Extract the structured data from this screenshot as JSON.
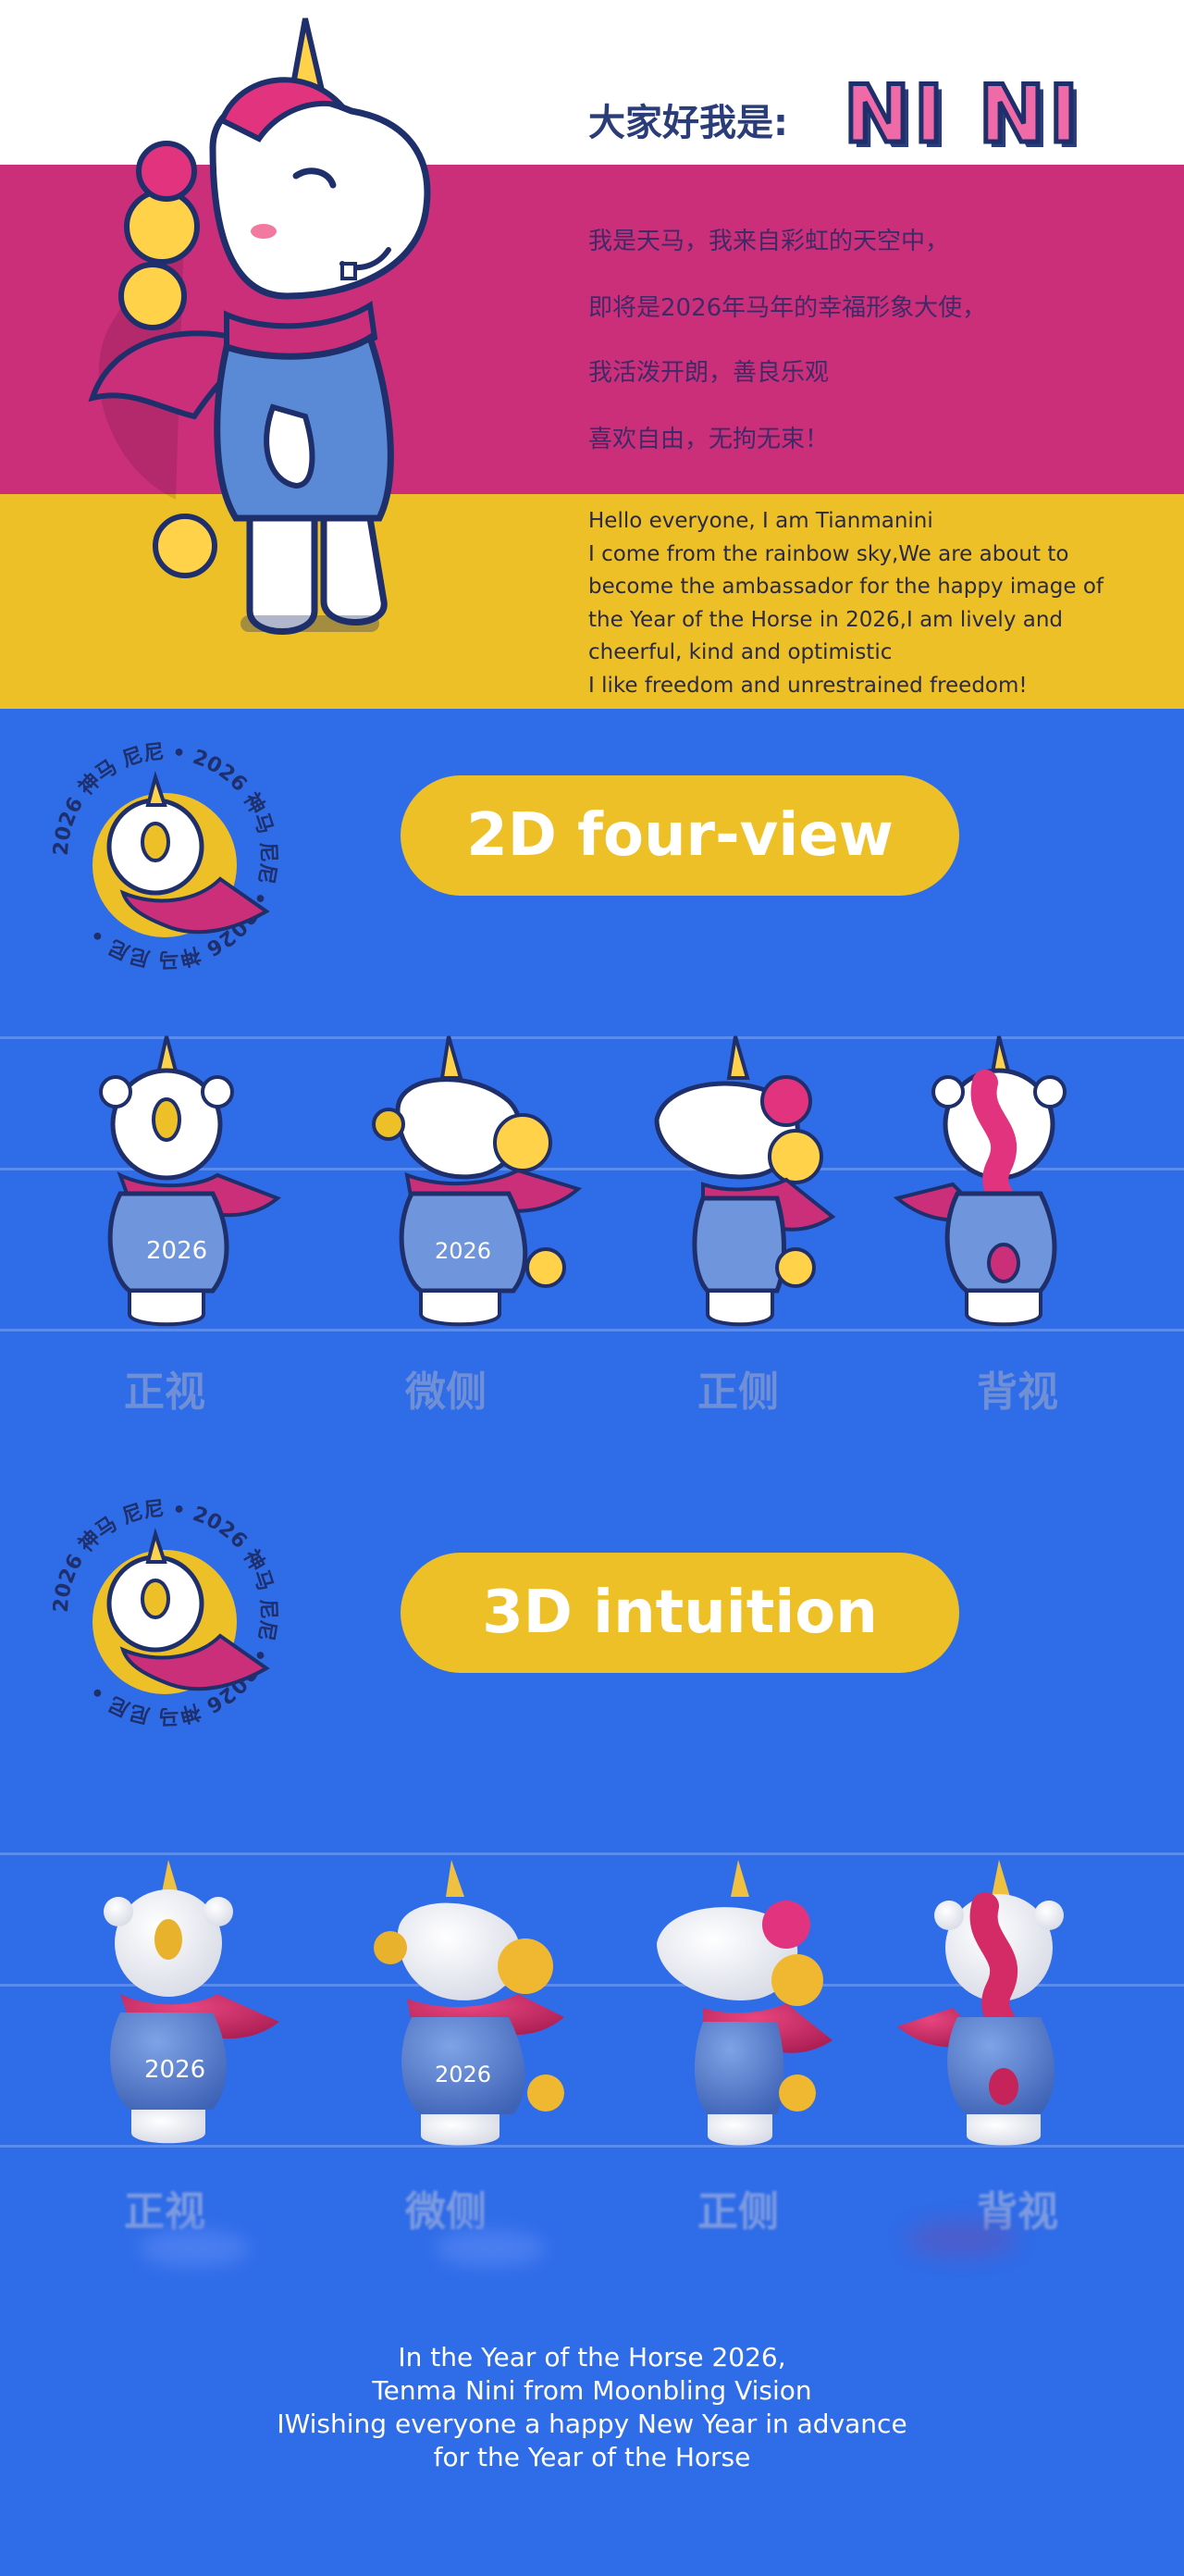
{
  "intro": {
    "greeting": "大家好我是:",
    "logo_text": "NI NI",
    "cn_lines": [
      "我是天马，我来自彩虹的天空中，",
      "即将是2026年马年的幸福形象大使，",
      "我活泼开朗，善良乐观",
      "喜欢自由，无拘无束！"
    ],
    "en_lines": [
      "Hello everyone, I am Tianmanini",
      "I come from the rainbow sky,We are about to",
      "become the ambassador for the happy image of",
      "the Year of the Horse in 2026,I am lively and",
      "cheerful, kind and optimistic",
      "I like freedom and unrestrained freedom!"
    ]
  },
  "badge": {
    "ring_text": "2026 神马 尼尼 • 2026 神马 尼尼 • 2026 神马 尼尼 •",
    "shirt_text": "2026"
  },
  "section_2d": {
    "title": "2D four-view",
    "labels": [
      "正视",
      "微侧",
      "正侧",
      "背视"
    ]
  },
  "section_3d": {
    "title": "3D intuition",
    "labels": [
      "正视",
      "微侧",
      "正侧",
      "背视"
    ]
  },
  "footer": {
    "lines": [
      "In the Year of the Horse 2026,",
      "Tenma Nini from Moonbling Vision",
      "IWishing everyone a happy New Year in advance",
      "for the Year of the Horse"
    ]
  },
  "colors": {
    "blue_bg": "#2f6ce8",
    "pink": "#cc2f7a",
    "yellow": "#edc028",
    "navy": "#1e2f6b",
    "scarf": "#d2306f",
    "shirt": "#5a8ad6"
  }
}
